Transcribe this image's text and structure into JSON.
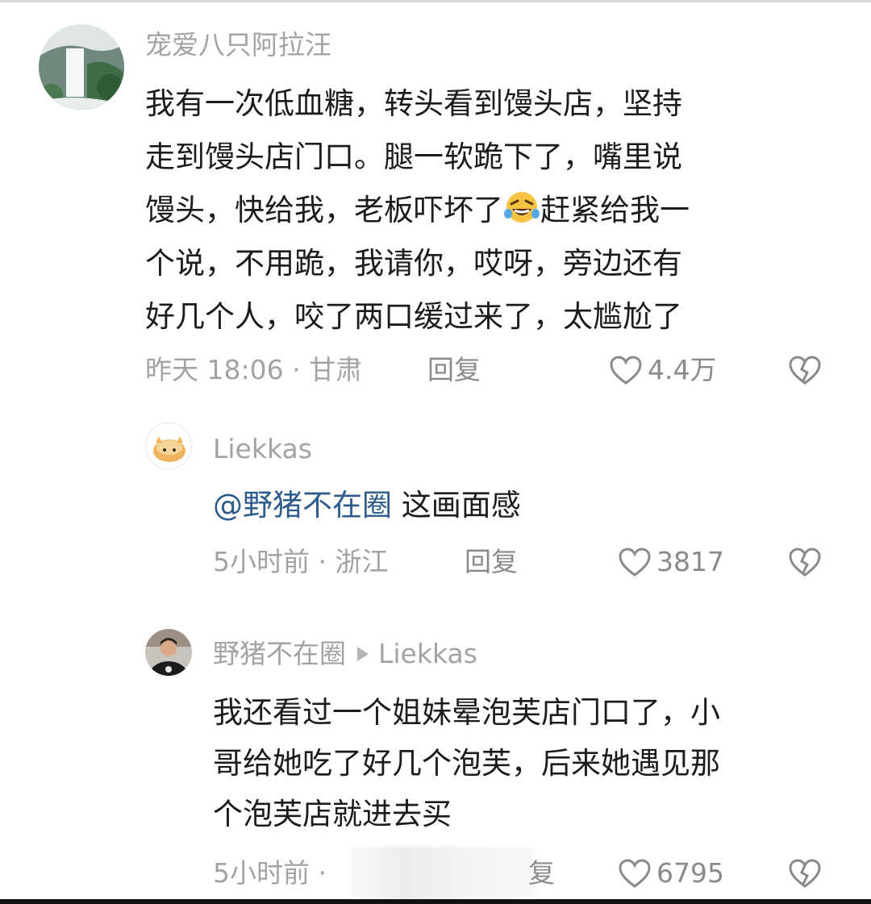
{
  "comments": [
    {
      "username": "宠爱八只阿拉汪",
      "lines": [
        "我有一次低血糖，转头看到馒头店，坚持",
        "走到馒头店门口。腿一软跪下了，嘴里说",
        "馒头，快给我，老板吓坏了",
        "个说，不用跪，我请你，哎呀，旁边还有",
        "好几个人，咬了两口缓过来了，太尴尬了"
      ],
      "line3_after_emoji": "赶紧给我一",
      "emoji": "rofl-emoji",
      "time": "昨天 18:06",
      "location": "甘肃",
      "reply_label": "回复",
      "likes": "4.4万"
    },
    {
      "username": "Liekkas",
      "mention": "@野猪不在圈",
      "text": " 这画面感",
      "time": "5小时前",
      "location": "浙江",
      "reply_label": "回复",
      "likes": "3817"
    },
    {
      "username": "野猪不在圈",
      "reply_to": "Liekkas",
      "lines": [
        "我还看过一个姐妹晕泡芙店门口了，小",
        "哥给她吃了好几个泡芙，后来她遇见那",
        "个泡芙店就进去买"
      ],
      "time": "5小时前",
      "reply_label_visible": "复",
      "likes": "6795"
    }
  ],
  "colors": {
    "text": "#1c1c1c",
    "meta": "#a3a3a3",
    "mention": "#2d5b8c"
  }
}
